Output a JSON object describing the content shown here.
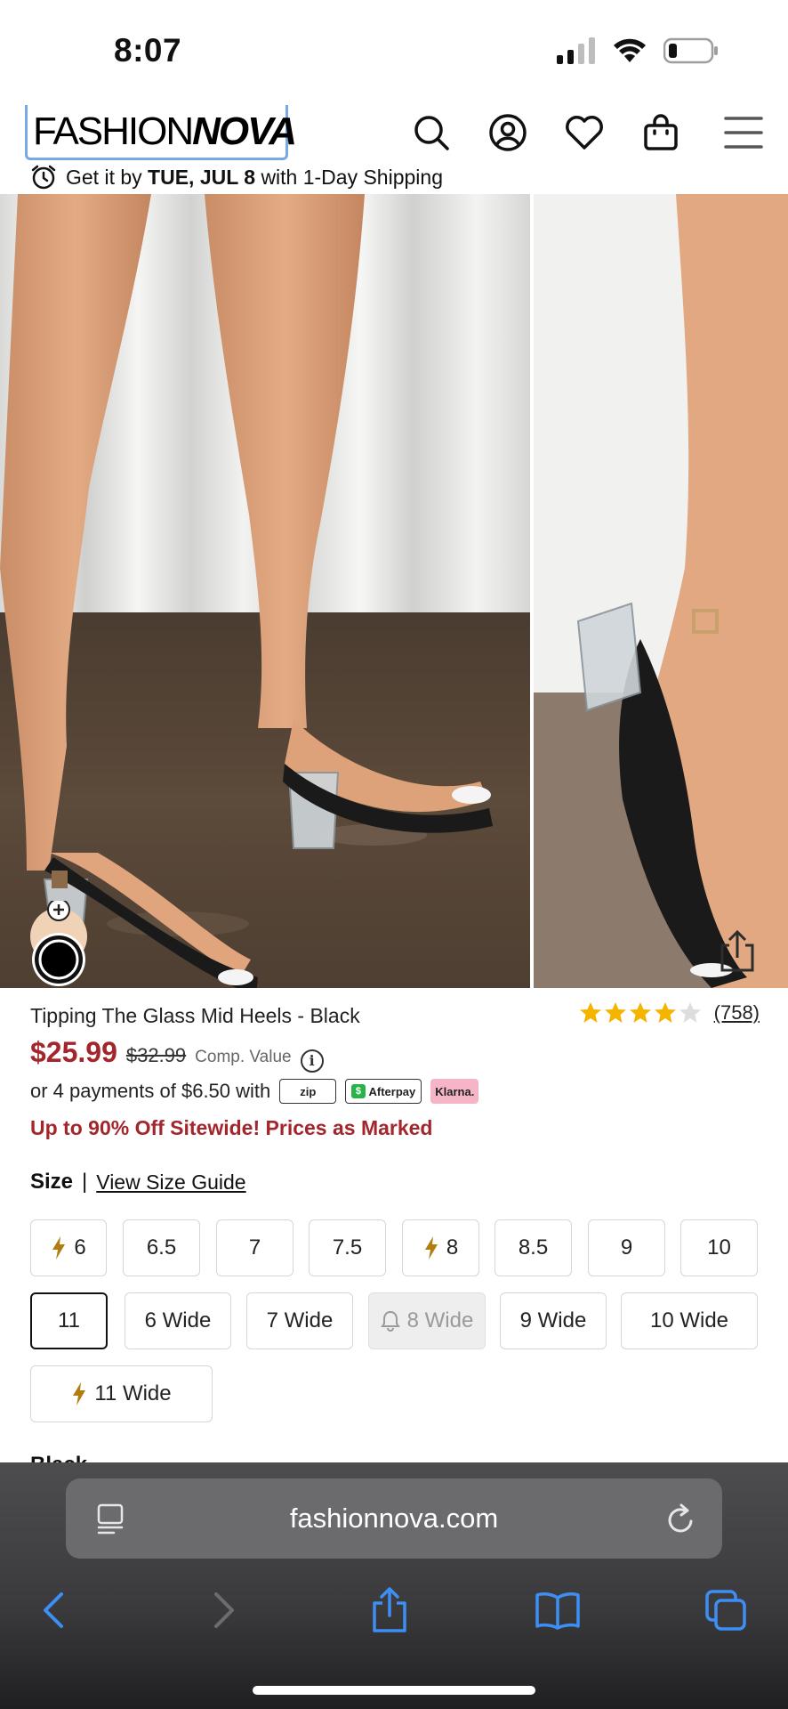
{
  "status_bar": {
    "time": "8:07"
  },
  "header": {
    "logo_light": "FASHION",
    "logo_bold": "NOVA",
    "icons": [
      "search-icon",
      "account-icon",
      "heart-icon",
      "bag-icon",
      "menu-icon"
    ]
  },
  "shipping": {
    "prefix": "Get it by",
    "date": "TUE, JUL 8",
    "suffix": "with 1-Day Shipping"
  },
  "gallery": {
    "slide_count": 3,
    "active_slide": 1
  },
  "product": {
    "title": "Tipping The Glass Mid Heels - Black",
    "rating": 4.3,
    "rating_max": 5,
    "review_count": "(758)",
    "price": "$25.99",
    "compare_price": "$32.99",
    "compare_label": "Comp. Value",
    "installments": "or 4 payments of $6.50 with",
    "payment_providers": [
      "zip",
      "Afterpay",
      "Klarna."
    ],
    "promo": "Up to 90% Off Sitewide! Prices as Marked"
  },
  "sizes": {
    "label": "Size",
    "separator": "|",
    "guide": "View Size Guide",
    "options": [
      {
        "label": "6",
        "flash": true,
        "selected": false,
        "available": true
      },
      {
        "label": "6.5",
        "flash": false,
        "selected": false,
        "available": true
      },
      {
        "label": "7",
        "flash": false,
        "selected": false,
        "available": true
      },
      {
        "label": "7.5",
        "flash": false,
        "selected": false,
        "available": true
      },
      {
        "label": "8",
        "flash": true,
        "selected": false,
        "available": true
      },
      {
        "label": "8.5",
        "flash": false,
        "selected": false,
        "available": true
      },
      {
        "label": "9",
        "flash": false,
        "selected": false,
        "available": true
      },
      {
        "label": "10",
        "flash": false,
        "selected": false,
        "available": true
      },
      {
        "label": "11",
        "flash": false,
        "selected": true,
        "available": true
      },
      {
        "label": "6 Wide",
        "flash": false,
        "selected": false,
        "available": true
      },
      {
        "label": "7 Wide",
        "flash": false,
        "selected": false,
        "available": true
      },
      {
        "label": "8 Wide",
        "flash": false,
        "selected": false,
        "available": false
      },
      {
        "label": "9 Wide",
        "flash": false,
        "selected": false,
        "available": true
      },
      {
        "label": "10 Wide",
        "flash": false,
        "selected": false,
        "available": true
      },
      {
        "label": "11 Wide",
        "flash": true,
        "selected": false,
        "available": true
      }
    ]
  },
  "color_label": "Black",
  "browser": {
    "url": "fashionnova.com",
    "toolbar": [
      "back-icon",
      "forward-icon",
      "share-icon",
      "bookmarks-icon",
      "tabs-icon"
    ]
  },
  "colors": {
    "price_red": "#a3262c",
    "flash_gold": "#b07d10",
    "safari_blue": "#3d8ff5"
  }
}
